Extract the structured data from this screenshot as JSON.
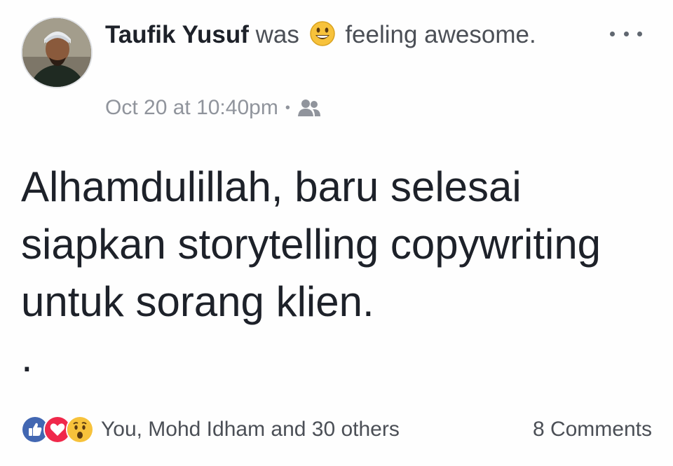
{
  "post": {
    "author": "Taufik Yusuf",
    "activity_prefix": "was",
    "activity_emoji": "smiling-emoji-icon",
    "activity_text": "feeling awesome.",
    "timestamp": "Oct 20 at 10:40pm",
    "separator": "•",
    "audience_icon": "friends-icon",
    "body_line_1": "Alhamdulillah, baru selesai",
    "body_line_2": "siapkan storytelling copywriting",
    "body_line_3": "untuk sorang klien.",
    "body_trailing": "."
  },
  "reactions": {
    "icons": [
      "like-icon",
      "love-icon",
      "wow-icon"
    ],
    "summary": "You, Mohd Idham and 30 others"
  },
  "comments": {
    "label": "8 Comments"
  },
  "colors": {
    "like": "#4267b2",
    "love": "#f0284a",
    "wow": "#f7c23b",
    "name": "#1d2129",
    "secondary": "#90949c"
  }
}
